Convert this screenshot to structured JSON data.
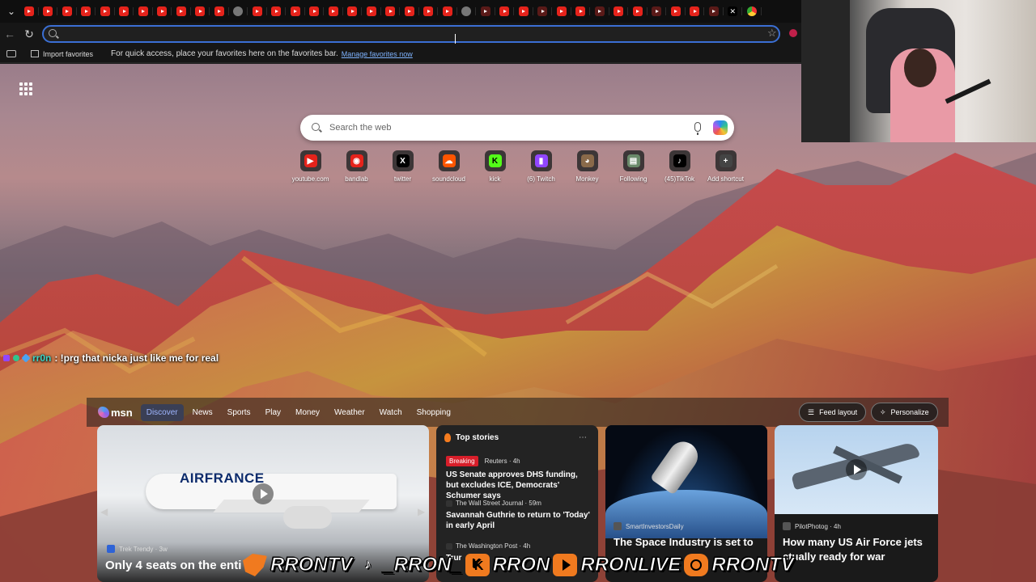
{
  "browser": {
    "tabs": [
      "youtube",
      "youtube",
      "youtube",
      "youtube",
      "youtube",
      "youtube",
      "youtube",
      "youtube",
      "youtube",
      "youtube",
      "youtube",
      "globe",
      "youtube",
      "youtube",
      "youtube",
      "youtube",
      "youtube",
      "youtube",
      "youtube",
      "youtube",
      "youtube",
      "youtube",
      "youtube",
      "globe",
      "youtube",
      "youtube",
      "youtube",
      "youtube",
      "youtube",
      "youtube",
      "youtube",
      "youtube",
      "youtube",
      "youtube",
      "youtube",
      "youtube",
      "youtube",
      "x",
      "chrome"
    ],
    "address_value": "",
    "address_placeholder": "",
    "favorites_bar": {
      "import_label": "Import favorites",
      "message": "For quick access, place your favorites here on the favorites bar.",
      "manage_link": "Manage favorites now"
    }
  },
  "newtab": {
    "search_placeholder": "Search the web",
    "shortcuts": [
      {
        "label": "youtube.com",
        "icon": "youtube-icon",
        "color": "#e5231b"
      },
      {
        "label": "bandlab",
        "icon": "bandlab-icon",
        "color": "#e5231b"
      },
      {
        "label": "twitter",
        "icon": "x-icon",
        "color": "#000000"
      },
      {
        "label": "soundcloud",
        "icon": "soundcloud-icon",
        "color": "#ff5500"
      },
      {
        "label": "kick",
        "icon": "kick-icon",
        "color": "#53fc18"
      },
      {
        "label": "(6) Twitch",
        "icon": "twitch-icon",
        "color": "#9146ff"
      },
      {
        "label": "Monkey",
        "icon": "monkey-icon",
        "color": "#8a6a4a"
      },
      {
        "label": "Following",
        "icon": "page-icon",
        "color": "#6a8a6a"
      },
      {
        "label": "(45)TikTok",
        "icon": "tiktok-icon",
        "color": "#000000"
      },
      {
        "label": "Add shortcut",
        "icon": "plus-icon",
        "color": "#444444"
      }
    ]
  },
  "chat": {
    "username": "rr0n",
    "message": ": !prg that nicka just like me for real"
  },
  "msn": {
    "logo": "msn",
    "nav": [
      "Discover",
      "News",
      "Sports",
      "Play",
      "Money",
      "Weather",
      "Watch",
      "Shopping"
    ],
    "active_nav": "Discover",
    "feed_layout": "Feed layout",
    "personalize": "Personalize",
    "hero": {
      "source": "Trek Trendy · 3w",
      "title": "Only 4 seats on the enti",
      "brand": "AIRFRANCE"
    },
    "top_stories": {
      "heading": "Top stories",
      "items": [
        {
          "badge": "Breaking",
          "source": "Reuters · 4h",
          "title": "US Senate approves DHS funding, but excludes ICE, Democrats' Schumer says"
        },
        {
          "badge": "",
          "source": "The Wall Street Journal · 59m",
          "title": "Savannah Guthrie to return to 'Today' in early April"
        },
        {
          "badge": "",
          "source": "The Washington Post · 4h",
          "title": "Trur"
        }
      ]
    },
    "space_card": {
      "source": "SmartInvestorsDaily",
      "title": "The Space Industry is set to"
    },
    "jet_card": {
      "source": "PilotPhotog · 4h",
      "title": "How many US Air Force jets ctually ready for war"
    }
  },
  "overlay": {
    "socials": [
      "RRONTV",
      "_RRON_",
      "RRON",
      "RRONLIVE",
      "RRONTV"
    ]
  }
}
